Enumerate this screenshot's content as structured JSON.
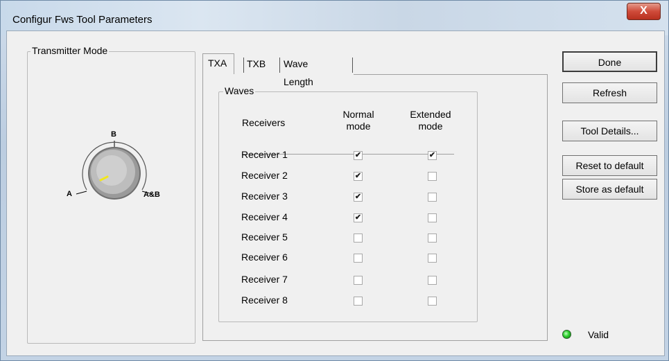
{
  "window": {
    "title": "Configur Fws Tool Parameters",
    "close_label": "X"
  },
  "transmitter": {
    "legend": "Transmitter Mode",
    "dial_labels": {
      "a": "A",
      "b": "B",
      "ab": "A&B"
    }
  },
  "tabs": [
    {
      "label": "TXA",
      "active": true
    },
    {
      "label": "TXB",
      "active": false
    },
    {
      "label": "Wave Length",
      "active": false
    }
  ],
  "waves": {
    "legend": "Waves",
    "col_receivers": "Receivers",
    "col_normal": "Normal\nmode",
    "col_extended": "Extended\nmode",
    "rows": [
      {
        "label": "Receiver 1",
        "normal": true,
        "extended": true
      },
      {
        "label": "Receiver 2",
        "normal": true,
        "extended": false
      },
      {
        "label": "Receiver 3",
        "normal": true,
        "extended": false
      },
      {
        "label": "Receiver 4",
        "normal": true,
        "extended": false
      },
      {
        "label": "Receiver 5",
        "normal": false,
        "extended": false
      },
      {
        "label": "Receiver 6",
        "normal": false,
        "extended": false
      },
      {
        "label": "Receiver 7",
        "normal": false,
        "extended": false
      },
      {
        "label": "Receiver 8",
        "normal": false,
        "extended": false
      }
    ]
  },
  "buttons": {
    "done": "Done",
    "refresh": "Refresh",
    "tool_details": "Tool Details...",
    "reset": "Reset to default",
    "store": "Store as default"
  },
  "status": {
    "label": "Valid",
    "color": "#2ccf2c"
  }
}
